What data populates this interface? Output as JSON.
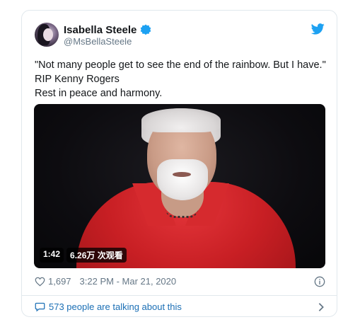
{
  "tweet": {
    "display_name": "Isabella Steele",
    "handle": "@MsBellaSteele",
    "text_lines": [
      "\"Not many people get to see the end of the rainbow. But I have.\"",
      "RIP Kenny Rogers",
      "Rest in peace and harmony."
    ],
    "video": {
      "duration": "1:42",
      "views": "6.26万 次观看"
    },
    "likes": "1,697",
    "timestamp": "3:22 PM - Mar 21, 2020",
    "talking_link": "573 people are talking about this"
  },
  "colors": {
    "twitter_blue": "#1da1f2",
    "link_blue": "#1b6fb5",
    "muted": "#657786",
    "border": "#e1e8ed"
  },
  "icons": [
    "verified-badge-icon",
    "twitter-bird-icon",
    "heart-icon",
    "info-icon",
    "speech-bubble-icon",
    "chevron-right-icon"
  ]
}
